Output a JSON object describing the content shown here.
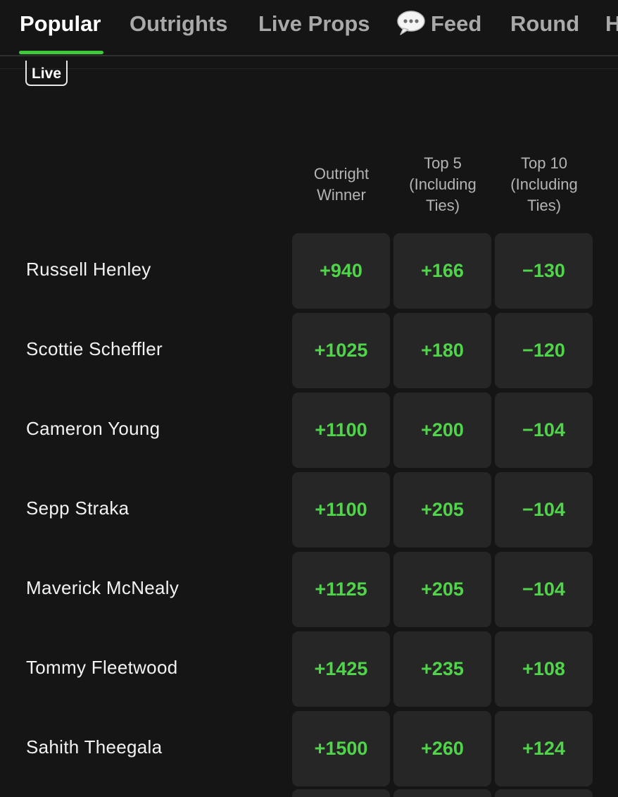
{
  "tabs": [
    {
      "label": "Popular",
      "active": true
    },
    {
      "label": "Outrights"
    },
    {
      "label": "Live Props"
    },
    {
      "label": "Feed",
      "icon": "speech-bubble-icon"
    },
    {
      "label": "Round"
    },
    {
      "label": "H"
    }
  ],
  "live_badge": "Live",
  "columns": [
    "Outright\nWinner",
    "Top 5\n(Including\nTies)",
    "Top 10\n(Including\nTies)"
  ],
  "rows": [
    {
      "player": "Russell Henley",
      "odds": [
        "+940",
        "+166",
        "−130"
      ]
    },
    {
      "player": "Scottie Scheffler",
      "odds": [
        "+1025",
        "+180",
        "−120"
      ]
    },
    {
      "player": "Cameron Young",
      "odds": [
        "+1100",
        "+200",
        "−104"
      ]
    },
    {
      "player": "Sepp Straka",
      "odds": [
        "+1100",
        "+205",
        "−104"
      ]
    },
    {
      "player": "Maverick McNealy",
      "odds": [
        "+1125",
        "+205",
        "−104"
      ]
    },
    {
      "player": "Tommy Fleetwood",
      "odds": [
        "+1425",
        "+235",
        "+108"
      ]
    },
    {
      "player": "Sahith Theegala",
      "odds": [
        "+1500",
        "+260",
        "+124"
      ]
    }
  ],
  "colors": {
    "accent": "#3ec93a",
    "odds_text": "#4fd44a",
    "cell_bg": "#262626",
    "background": "#151515"
  }
}
